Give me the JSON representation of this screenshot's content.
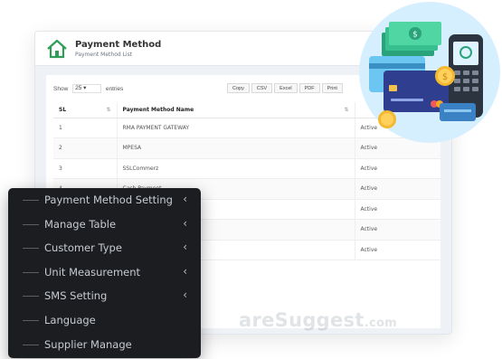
{
  "header": {
    "title": "Payment Method",
    "subtitle": "Payment Method List"
  },
  "controls": {
    "show_label": "Show",
    "entries_value": "25",
    "entries_label": "entries",
    "export_buttons": [
      "Copy",
      "CSV",
      "Excel",
      "PDF",
      "Print"
    ]
  },
  "table": {
    "columns": [
      "SL",
      "Payment Method Name",
      ""
    ],
    "rows": [
      {
        "sl": "1",
        "name": "RMA PAYMENT GATEWAY",
        "status": "Active"
      },
      {
        "sl": "2",
        "name": "MPESA",
        "status": "Active"
      },
      {
        "sl": "3",
        "name": "SSLCommerz",
        "status": "Active"
      },
      {
        "sl": "4",
        "name": "Cash Payment",
        "status": "Active"
      },
      {
        "sl": "",
        "name": "",
        "status": "Active"
      },
      {
        "sl": "",
        "name": "",
        "status": "Active"
      },
      {
        "sl": "",
        "name": "",
        "status": "Active"
      }
    ]
  },
  "watermark": "areSuggest",
  "watermark_suffix": ".com",
  "menu": {
    "items": [
      {
        "label": "Payment Method Setting",
        "chevron": true
      },
      {
        "label": "Manage Table",
        "chevron": true
      },
      {
        "label": "Customer Type",
        "chevron": true
      },
      {
        "label": "Unit Measurement",
        "chevron": true
      },
      {
        "label": "SMS Setting",
        "chevron": true
      },
      {
        "label": "Language",
        "chevron": false
      },
      {
        "label": "Supplier Manage",
        "chevron": false
      }
    ]
  },
  "icons": {
    "home": "home-icon",
    "sort": "sort-icon",
    "chevron": "chevron-left-icon",
    "illustration": "payment-illustration"
  },
  "colors": {
    "menu_bg": "#1b1d20",
    "accent_green": "#2e9d58",
    "illustration_bg": "#d6efff"
  }
}
